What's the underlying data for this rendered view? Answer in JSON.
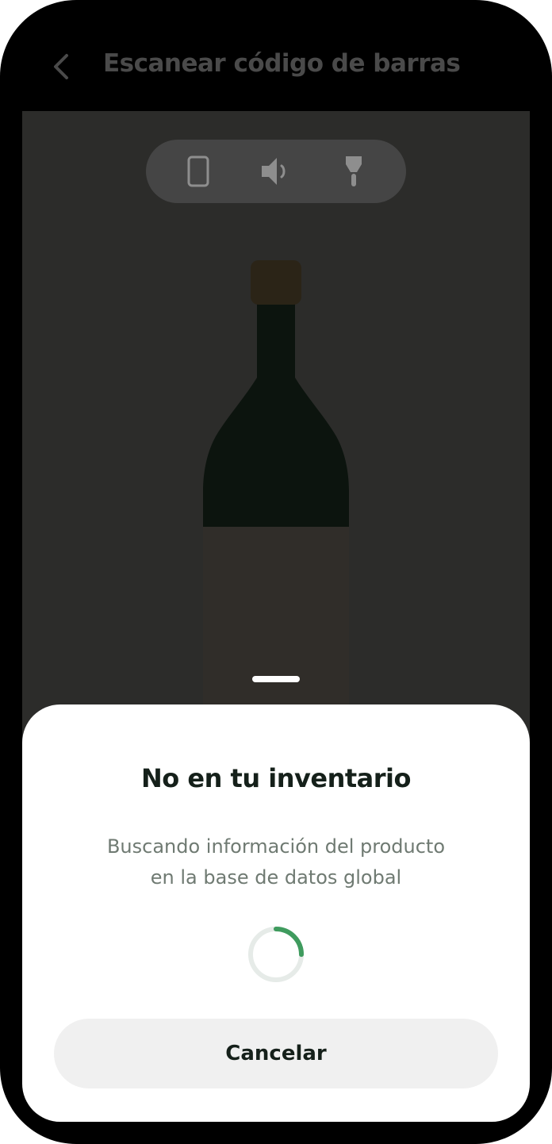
{
  "header": {
    "title": "Escanear código de barras",
    "back_icon": "chevron-left-icon"
  },
  "camera": {
    "controls": [
      {
        "name": "phone-icon",
        "label": ""
      },
      {
        "name": "speaker-icon",
        "label": ""
      },
      {
        "name": "flashlight-icon",
        "label": ""
      }
    ]
  },
  "sheet": {
    "title": "No en tu inventario",
    "description_line1": "Buscando información del producto",
    "description_line2": "en la base de datos global",
    "loading_progress": 0.25,
    "cancel_label": "Cancelar"
  },
  "colors": {
    "spinner_accent": "#3f9b5e",
    "spinner_track": "#e6ebe8",
    "bottle_glass": "#0c140e",
    "bottle_cap": "#2b2417",
    "bottle_label": "#302d29"
  }
}
